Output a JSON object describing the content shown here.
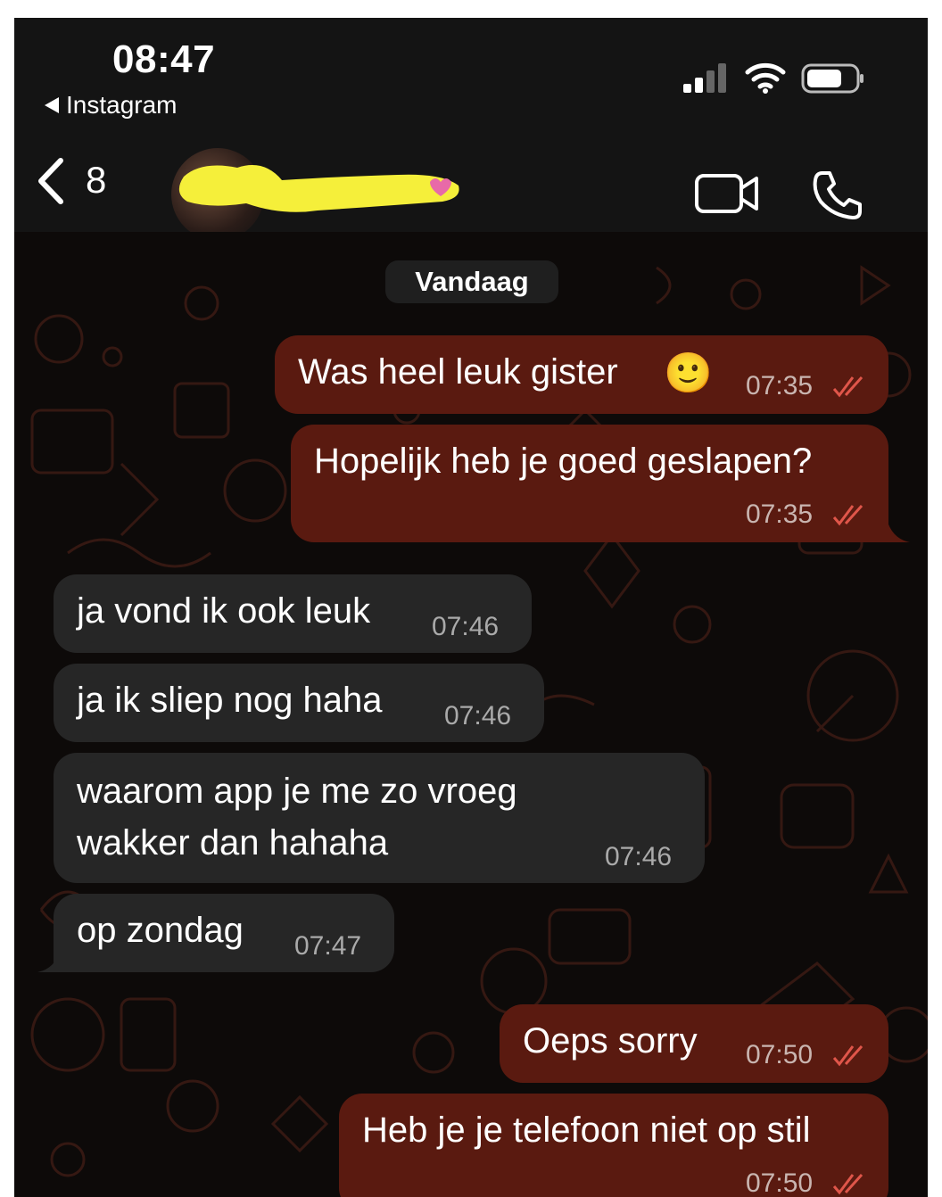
{
  "status_bar": {
    "time": "08:47",
    "back_app_label": "Instagram"
  },
  "header": {
    "unread_count": "8",
    "contact_name_hidden": true
  },
  "chat": {
    "date_separator": "Vandaag",
    "messages": [
      {
        "dir": "out",
        "text": "Was heel leuk gister",
        "emoji": "🙂",
        "time": "07:35",
        "read": true
      },
      {
        "dir": "out",
        "text": "Hopelijk heb je goed geslapen?",
        "time": "07:35",
        "read": true
      },
      {
        "dir": "in",
        "text": "ja vond ik ook leuk",
        "time": "07:46"
      },
      {
        "dir": "in",
        "text": "ja ik sliep nog haha",
        "time": "07:46"
      },
      {
        "dir": "in",
        "text": "waarom app je me zo vroeg\nwakker dan hahaha",
        "time": "07:46"
      },
      {
        "dir": "in",
        "text": "op zondag",
        "time": "07:47"
      },
      {
        "dir": "out",
        "text": "Oeps sorry",
        "time": "07:50",
        "read": true
      },
      {
        "dir": "out",
        "text": "Heb je je telefoon niet op stil",
        "time": "07:50",
        "read": true
      }
    ]
  },
  "colors": {
    "outgoing_bubble": "#5a1a10",
    "incoming_bubble": "#262626",
    "read_ticks": "#e0564a",
    "background": "#0d0a09"
  },
  "icons": {
    "signal": "signal-bars-icon",
    "wifi": "wifi-icon",
    "battery": "battery-icon",
    "back": "chevron-left-icon",
    "video": "video-camera-icon",
    "call": "phone-icon",
    "read": "double-check-icon"
  }
}
